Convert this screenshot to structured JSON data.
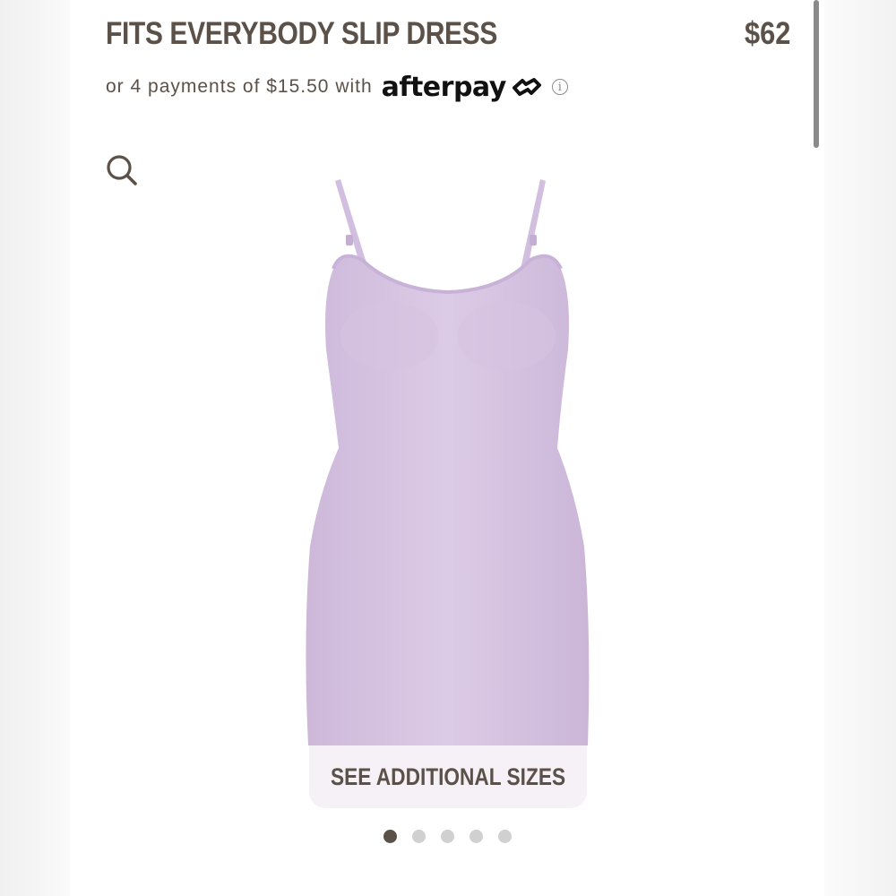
{
  "product": {
    "title": "FITS EVERYBODY SLIP DRESS",
    "price": "$62"
  },
  "payment": {
    "installment_text": "or 4 payments of $15.50 with",
    "provider": "afterpay",
    "info_icon": "info-icon"
  },
  "gallery": {
    "search_icon": "search-icon",
    "image": "lavender slip dress",
    "dress_color": "#dccbe6",
    "see_sizes_label": "SEE ADDITIONAL SIZES",
    "dots": [
      {
        "active": true
      },
      {
        "active": false
      },
      {
        "active": false
      },
      {
        "active": false
      },
      {
        "active": false
      }
    ]
  },
  "colors": {
    "text": "#5b5148",
    "active_dot": "#5b5148",
    "inactive_dot": "#d0d0d0"
  }
}
